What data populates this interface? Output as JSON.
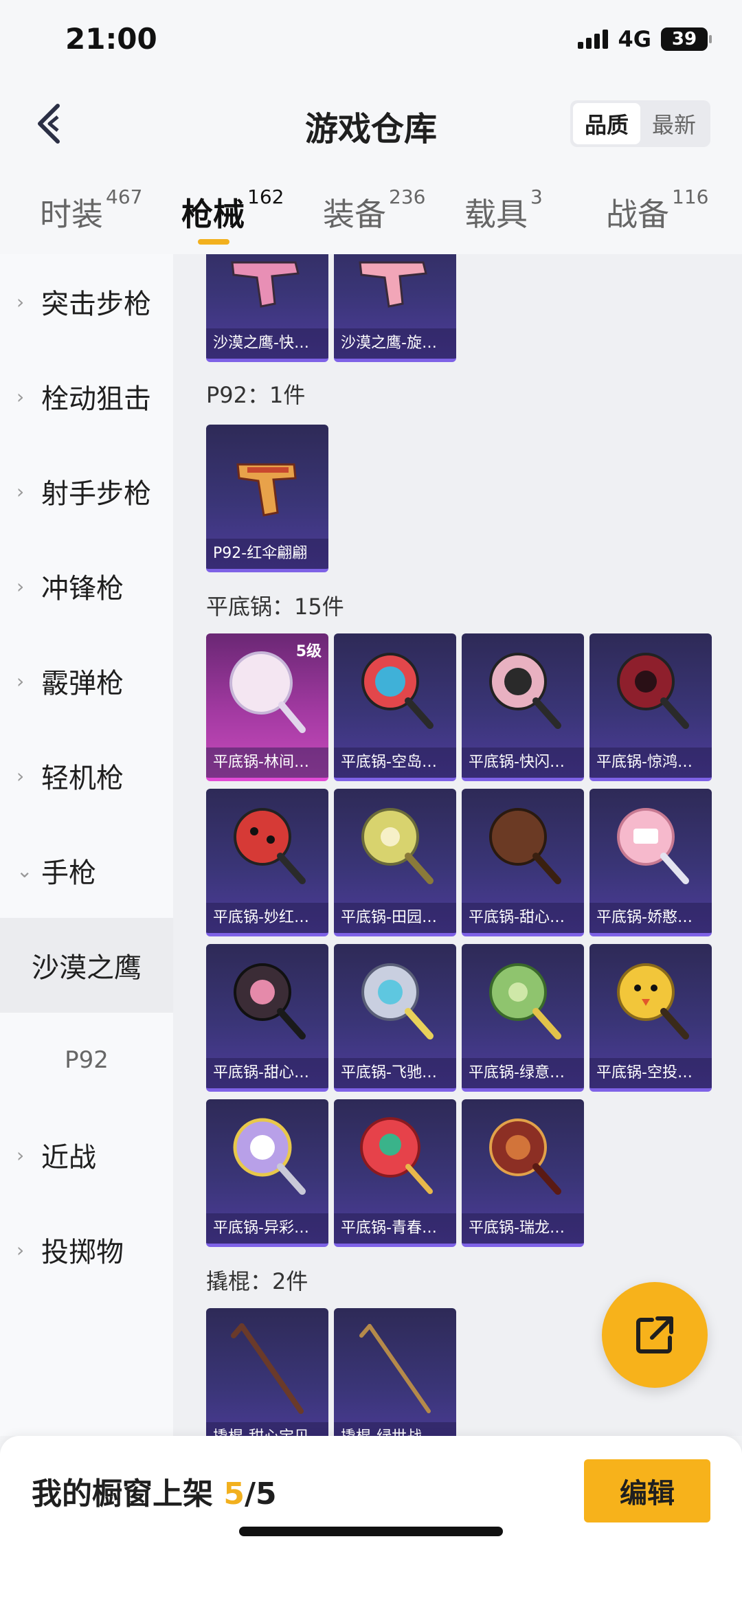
{
  "status_bar": {
    "time": "21:00",
    "network": "4G",
    "battery": "39"
  },
  "header": {
    "title": "游戏仓库",
    "sort_options": [
      "品质",
      "最新"
    ],
    "active_sort": "品质"
  },
  "tabs": [
    {
      "label": "时装",
      "count": "467"
    },
    {
      "label": "枪械",
      "count": "162",
      "active": true
    },
    {
      "label": "装备",
      "count": "236"
    },
    {
      "label": "载具",
      "count": "3"
    },
    {
      "label": "战备",
      "count": "116"
    }
  ],
  "sidebar": {
    "items": [
      {
        "label": "突击步枪"
      },
      {
        "label": "栓动狙击"
      },
      {
        "label": "射手步枪"
      },
      {
        "label": "冲锋枪"
      },
      {
        "label": "霰弹枪"
      },
      {
        "label": "轻机枪"
      },
      {
        "label": "手枪",
        "expanded": true
      },
      {
        "label": "沙漠之鹰",
        "sub": true,
        "selected": true
      },
      {
        "label": "P92",
        "sub": true
      },
      {
        "label": "近战"
      },
      {
        "label": "投掷物"
      }
    ]
  },
  "sections": {
    "desert_eagle": {
      "items": [
        {
          "label": "沙漠之鹰-快…",
          "icon": "pink-pistol-icon"
        },
        {
          "label": "沙漠之鹰-旋…",
          "icon": "pink-pistol-icon"
        }
      ]
    },
    "p92": {
      "title": "P92：1件",
      "items": [
        {
          "label": "P92-红伞翩翩",
          "icon": "gold-pistol-icon"
        }
      ]
    },
    "pan": {
      "title": "平底锅：15件",
      "items": [
        {
          "label": "平底锅-林间…",
          "level": "5级",
          "icon": "mirror-pan-icon",
          "color": "#f4e6f2"
        },
        {
          "label": "平底锅-空岛…",
          "icon": "pan-icon",
          "color": "#e2474b"
        },
        {
          "label": "平底锅-快闪…",
          "icon": "pan-icon",
          "color": "#e8b1c1"
        },
        {
          "label": "平底锅-惊鸿…",
          "icon": "pan-icon",
          "color": "#8e1f2c"
        },
        {
          "label": "平底锅-妙红…",
          "icon": "pan-icon",
          "color": "#d63a36"
        },
        {
          "label": "平底锅-田园…",
          "icon": "pan-icon",
          "color": "#d8d36e"
        },
        {
          "label": "平底锅-甜心…",
          "icon": "pan-icon",
          "color": "#6b3a24"
        },
        {
          "label": "平底锅-娇憨…",
          "icon": "pan-icon",
          "color": "#f6b9cc"
        },
        {
          "label": "平底锅-甜心…",
          "icon": "pan-icon",
          "color": "#3b2c36"
        },
        {
          "label": "平底锅-飞驰…",
          "icon": "pan-icon",
          "color": "#c9cfe0"
        },
        {
          "label": "平底锅-绿意…",
          "icon": "pan-icon",
          "color": "#8fc46e"
        },
        {
          "label": "平底锅-空投…",
          "icon": "pan-icon",
          "color": "#f2c63a"
        },
        {
          "label": "平底锅-异彩…",
          "icon": "pan-icon",
          "color": "#b8a0e8"
        },
        {
          "label": "平底锅-青春…",
          "icon": "pan-icon",
          "color": "#e6424a"
        },
        {
          "label": "平底锅-瑞龙…",
          "icon": "pan-icon",
          "color": "#8c2f24"
        }
      ]
    },
    "crowbar": {
      "title": "撬棍：2件",
      "items": [
        {
          "label": "撬棍-甜心宝贝",
          "icon": "crowbar-icon",
          "color": "#6a3a2a"
        },
        {
          "label": "撬棍-绿世战",
          "icon": "crowbar-icon",
          "color": "#b58a4a"
        }
      ]
    }
  },
  "bottom": {
    "shelf_label": "我的橱窗上架 ",
    "shelf_current": "5",
    "shelf_total": "/5",
    "edit_label": "编辑"
  },
  "colors": {
    "accent": "#f7b21b",
    "card_purple": "#3a3577",
    "card_pink": "#a33aa2"
  }
}
